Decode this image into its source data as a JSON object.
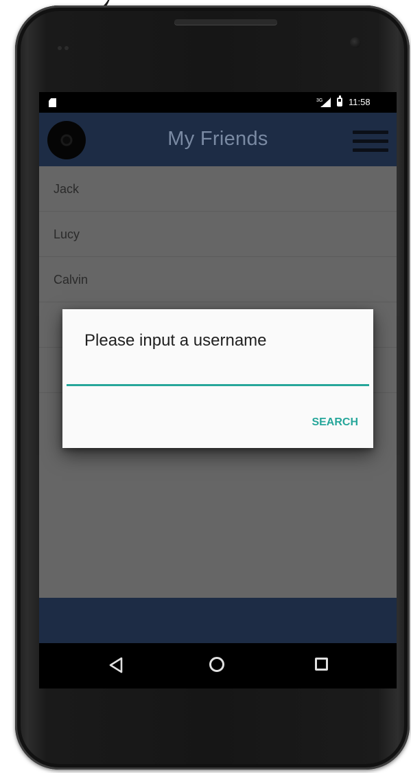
{
  "status_bar": {
    "time": "11:58",
    "network_label": "3G"
  },
  "app_bar": {
    "title": "My Friends"
  },
  "friends": [
    {
      "name": "Jack"
    },
    {
      "name": "Lucy"
    },
    {
      "name": "Calvin"
    },
    {
      "name": ""
    },
    {
      "name": ""
    }
  ],
  "dialog": {
    "title": "Please input a username",
    "input_value": "",
    "search_label": "SEARCH"
  },
  "colors": {
    "app_bar": "#1d2c45",
    "list_background": "#666666",
    "accent": "#26a69a",
    "dialog_background": "#fafafa"
  },
  "icons": {
    "app_logo": "app-logo-icon",
    "menu": "hamburger-menu-icon",
    "back": "nav-back-icon",
    "home": "nav-home-icon",
    "recents": "nav-recents-icon"
  }
}
